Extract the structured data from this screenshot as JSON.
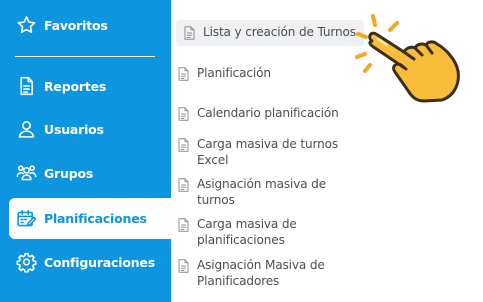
{
  "sidebar": {
    "items": [
      {
        "label": "Favoritos",
        "icon": "star-icon"
      },
      {
        "label": "Reportes",
        "icon": "report-icon"
      },
      {
        "label": "Usuarios",
        "icon": "user-icon"
      },
      {
        "label": "Grupos",
        "icon": "group-icon"
      },
      {
        "label": "Planificaciones",
        "icon": "calendar-edit-icon",
        "active": true
      },
      {
        "label": "Configuraciones",
        "icon": "gear-icon"
      }
    ],
    "background_color": "#0d96df",
    "active_text_color": "#0d96df"
  },
  "submenu": {
    "items": [
      {
        "label": "Lista y creación de Turnos",
        "highlighted": true
      },
      {
        "label": "Planificación"
      },
      {
        "label": "Calendario planificación"
      },
      {
        "label": "Carga masiva de turnos\nExcel"
      },
      {
        "label": "Asignación masiva de\nturnos"
      },
      {
        "label": "Carga masiva de\nplanificaciones"
      },
      {
        "label": "Asignación Masiva de\nPlanificadores"
      }
    ],
    "item_icon": "document-icon"
  },
  "pointer": {
    "icon": "pointing-hand-icon",
    "color": "#f7bd3b",
    "accent_color": "#f5a623"
  }
}
